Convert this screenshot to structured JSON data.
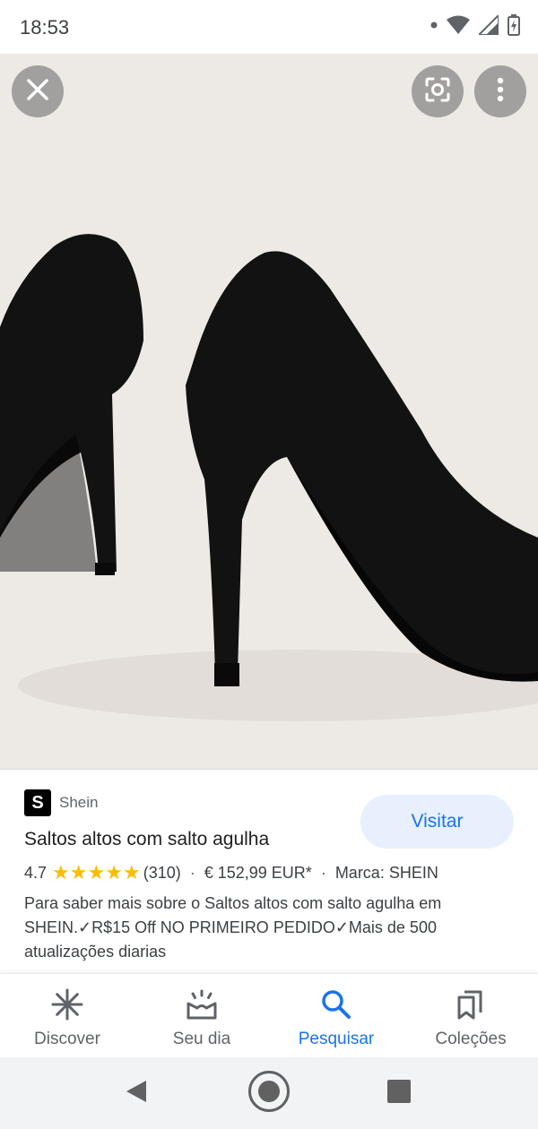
{
  "status_bar": {
    "time": "18:53",
    "icons": [
      "notification-dot-icon",
      "wifi-icon",
      "signal-icon",
      "battery-charging-icon"
    ]
  },
  "viewer": {
    "background_color": "#ede9e5",
    "buttons": [
      {
        "name": "close-button",
        "icon": "close-icon"
      },
      {
        "name": "lens-button",
        "icon": "google-lens-icon"
      },
      {
        "name": "more-options-button",
        "icon": "more-vertical-icon"
      }
    ]
  },
  "result": {
    "source_logo_letter": "S",
    "source_name": "Shein",
    "visit_label": "Visitar",
    "title": "Saltos altos com salto agulha",
    "rating": "4.7",
    "stars": 4.7,
    "review_count": "(310)",
    "separator": "·",
    "price": "€ 152,99 EUR*",
    "brand": "Marca: SHEIN",
    "description": "Para saber mais sobre o Saltos altos com salto agulha em SHEIN.✓R$15 Off NO PRIMEIRO PEDIDO✓Mais de 500 atualizações diarias"
  },
  "bottom_nav": {
    "items": [
      {
        "label": "Discover",
        "icon": "asterisk-icon",
        "active": false
      },
      {
        "label": "Seu dia",
        "icon": "sunrise-icon",
        "active": false
      },
      {
        "label": "Pesquisar",
        "icon": "search-icon",
        "active": true
      },
      {
        "label": "Coleções",
        "icon": "bookmarks-icon",
        "active": false
      }
    ]
  },
  "colors": {
    "accent": "#1a73e8",
    "star": "#fbbc04",
    "visit_button_bg": "#e8f0fe"
  }
}
